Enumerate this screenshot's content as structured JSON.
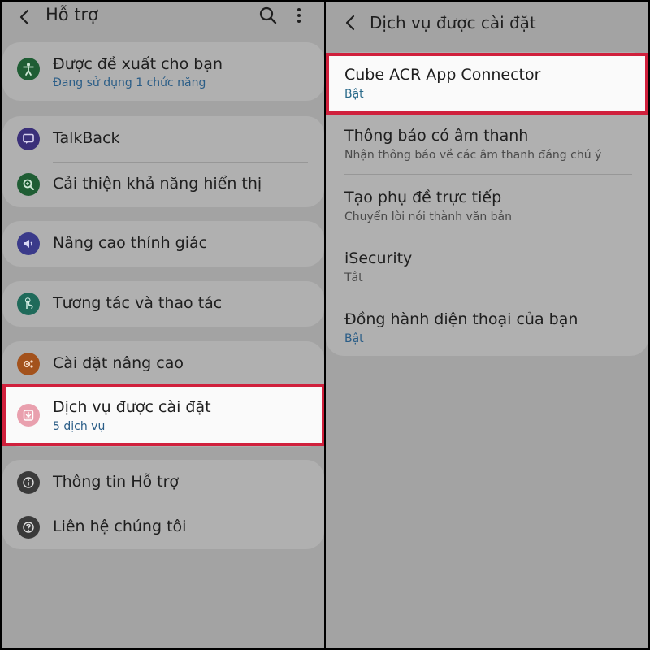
{
  "left": {
    "header": {
      "title": "Hỗ trợ"
    },
    "items": [
      {
        "title": "Được đề xuất cho bạn",
        "sub": "Đang sử dụng 1 chức năng",
        "icon": "accessibility-icon",
        "color": "#1f5d34"
      },
      {
        "title": "TalkBack",
        "icon": "talkback-icon",
        "color": "#3a2f79"
      },
      {
        "title": "Cải thiện khả năng hiển thị",
        "icon": "magnifier-icon",
        "color": "#1f5d34"
      },
      {
        "title": "Nâng cao thính giác",
        "icon": "hearing-icon",
        "color": "#3a3a8a"
      },
      {
        "title": "Tương tác và thao tác",
        "icon": "touch-icon",
        "color": "#1f6a5a"
      },
      {
        "title": "Cài đặt nâng cao",
        "icon": "gear-icon",
        "color": "#a3521c"
      },
      {
        "title": "Dịch vụ được cài đặt",
        "sub": "5 dịch vụ",
        "icon": "download-icon",
        "color": "#e9a0ae"
      },
      {
        "title": "Thông tin Hỗ trợ",
        "icon": "info-icon",
        "color": "#3a3a3a"
      },
      {
        "title": "Liên hệ chúng tôi",
        "icon": "help-icon",
        "color": "#3a3a3a"
      }
    ]
  },
  "right": {
    "header": {
      "title": "Dịch vụ được cài đặt"
    },
    "items": [
      {
        "title": "Cube ACR App Connector",
        "sub": "Bật",
        "sub_color": "#2a6a8a"
      },
      {
        "title": "Thông báo có âm thanh",
        "sub": "Nhận thông báo về các âm thanh đáng chú ý",
        "sub_color": "#4a4a4a"
      },
      {
        "title": "Tạo phụ đề trực tiếp",
        "sub": "Chuyển lời nói thành văn bản",
        "sub_color": "#4a4a4a"
      },
      {
        "title": " iSecurity",
        "sub": "Tắt",
        "sub_color": "#4a4a4a"
      },
      {
        "title": "Đồng hành điện thoại của bạn",
        "sub": "Bật",
        "sub_color": "#2a5d87"
      }
    ]
  }
}
